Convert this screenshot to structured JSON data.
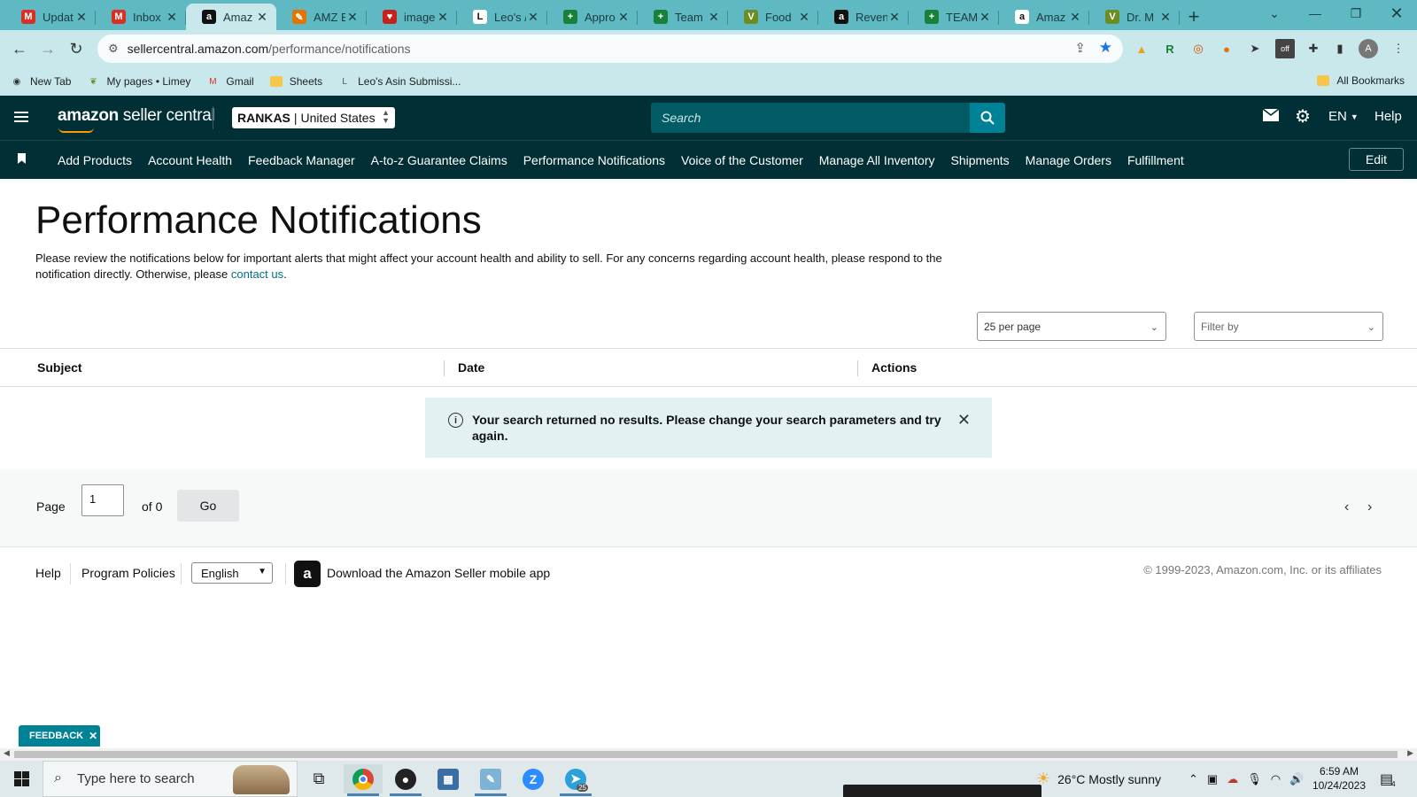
{
  "browser": {
    "tabs": [
      {
        "title": "Updat",
        "icon": "gmail-icon",
        "color": "#d93025",
        "glyph": "M"
      },
      {
        "title": "Inbox",
        "icon": "gmail-icon",
        "color": "#d93025",
        "glyph": "M"
      },
      {
        "title": "Amaz",
        "icon": "amazon-icon",
        "color": "#111111",
        "glyph": "a",
        "active": true
      },
      {
        "title": "AMZ E",
        "icon": "pencil-icon",
        "color": "#e37400",
        "glyph": "✎"
      },
      {
        "title": "image",
        "icon": "heart-icon",
        "color": "#c5221f",
        "glyph": "♥"
      },
      {
        "title": "Leo's /",
        "icon": "asin-icon",
        "color": "#ffffff",
        "glyph": "L"
      },
      {
        "title": "Appro",
        "icon": "sheets-icon",
        "color": "#188038",
        "glyph": "+"
      },
      {
        "title": "Team",
        "icon": "sheets-icon",
        "color": "#188038",
        "glyph": "+"
      },
      {
        "title": "Food",
        "icon": "leaf-icon",
        "color": "#6b8e23",
        "glyph": "V"
      },
      {
        "title": "Reven",
        "icon": "amazon-icon",
        "color": "#111111",
        "glyph": "a"
      },
      {
        "title": "TEAM",
        "icon": "sheets-icon",
        "color": "#188038",
        "glyph": "+"
      },
      {
        "title": "Amaz",
        "icon": "amazon-icon",
        "color": "#ffffff",
        "glyph": "a"
      },
      {
        "title": "Dr. M",
        "icon": "leaf-icon",
        "color": "#6b8e23",
        "glyph": "V"
      }
    ],
    "url_host": "sellercentral.amazon.com",
    "url_path": "/performance/notifications",
    "bookmarks": [
      {
        "label": "New Tab",
        "icon": "globe-icon"
      },
      {
        "label": "My pages • Limey",
        "icon": "leaf-icon"
      },
      {
        "label": "Gmail",
        "icon": "gmail-icon"
      },
      {
        "label": "Sheets",
        "icon": "folder-icon"
      },
      {
        "label": "Leo's Asin Submissi...",
        "icon": "asin-icon"
      }
    ],
    "all_bookmarks": "All Bookmarks",
    "profile_initial": "A"
  },
  "header": {
    "logo_bold": "amazon",
    "logo_sub": " seller central",
    "account_name": "RANKAS",
    "account_sep": "|",
    "marketplace": "United States",
    "search_placeholder": "Search",
    "language": "EN",
    "help": "Help"
  },
  "nav": {
    "links": [
      "Add Products",
      "Account Health",
      "Feedback Manager",
      "A-to-z Guarantee Claims",
      "Performance Notifications",
      "Voice of the Customer",
      "Manage All Inventory",
      "Shipments",
      "Manage Orders",
      "Fulfillment"
    ],
    "edit": "Edit"
  },
  "main": {
    "title": "Performance Notifications",
    "intro": "Please review the notifications below for important alerts that might affect your account health and ability to sell. For any concerns regarding account health, please respond to the notification directly. Otherwise, please ",
    "contact_link": "contact us",
    "intro_end": ".",
    "per_page": "25 per page",
    "filter_placeholder": "Filter by",
    "columns": [
      "Subject",
      "Date",
      "Actions"
    ],
    "alert_message": "Your search returned no results. Please change your search parameters and try again."
  },
  "pager": {
    "page_label": "Page",
    "page_value": "1",
    "of_label": "of 0",
    "go": "Go"
  },
  "footer": {
    "help": "Help",
    "program_policies": "Program Policies",
    "language": "English",
    "app_link": "Download the Amazon Seller mobile app",
    "copyright": "© 1999-2023, Amazon.com, Inc. or its affiliates"
  },
  "feedback": "FEEDBACK",
  "taskbar": {
    "search_placeholder": "Type here to search",
    "weather": "26°C  Mostly sunny",
    "time": "6:59 AM",
    "date": "10/24/2023",
    "notifications_count": "4",
    "telegram_badge": "25"
  }
}
